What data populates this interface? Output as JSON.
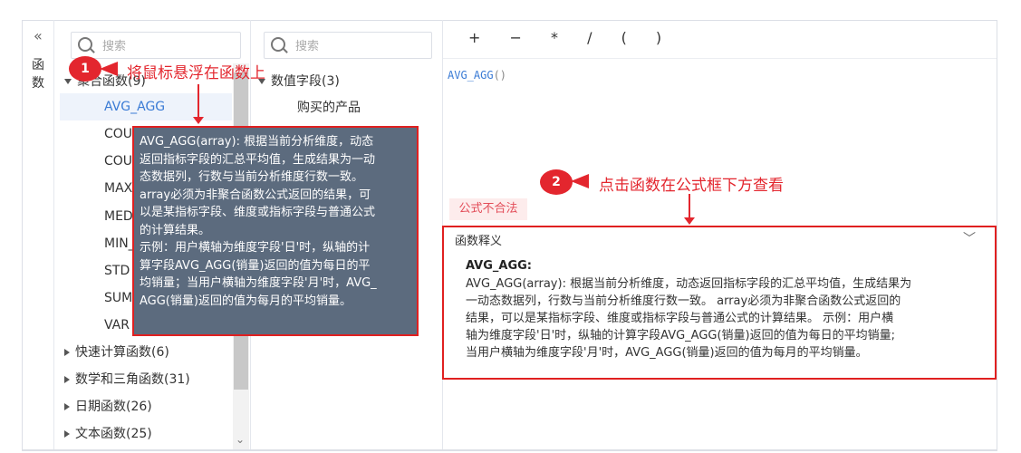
{
  "sidebar": {
    "label_chars": [
      "函",
      "数"
    ],
    "collapse_icon": "double-chevron-left-icon"
  },
  "function_panel": {
    "search_placeholder": "搜索",
    "groups": [
      {
        "label": "聚合函数(9)",
        "expanded": true
      },
      {
        "label": "快速计算函数(6)",
        "expanded": false
      },
      {
        "label": "数学和三角函数(31)",
        "expanded": false
      },
      {
        "label": "日期函数(26)",
        "expanded": false
      },
      {
        "label": "文本函数(25)",
        "expanded": false
      }
    ],
    "items": [
      "AVG_AGG",
      "COU",
      "COU",
      "MAX",
      "MED",
      "MIN_",
      "STD",
      "SUM",
      "VAR"
    ]
  },
  "field_panel": {
    "search_placeholder": "搜索",
    "group": "数值字段(3)",
    "items": [
      "购买的产品"
    ]
  },
  "editor": {
    "operators": [
      "+",
      "−",
      "*",
      "/",
      "(",
      ")"
    ],
    "formula_name": "AVG_AGG",
    "formula_parens": "()",
    "invalid_label": "公式不合法"
  },
  "explanation": {
    "title": "函数释义",
    "name": "AVG_AGG:",
    "lines": [
      "AVG_AGG(array): 根据当前分析维度，动态返回指标字段的汇总平均值，生成结果为",
      "一动态数据列，行数与当前分析维度行数一致。  array必须为非聚合函数公式返回的",
      "结果，可以是某指标字段、维度或指标字段与普通公式的计算结果。  示例：用户横",
      "轴为维度字段'日'时，纵轴的计算字段AVG_AGG(销量)返回的值为每日的平均销量;",
      "当用户横轴为维度字段'月'时，AVG_AGG(销量)返回的值为每月的平均销量。"
    ]
  },
  "tooltip": {
    "lines": [
      "AVG_AGG(array): 根据当前分析维度，动态",
      "返回指标字段的汇总平均值，生成结果为一动",
      "态数据列，行数与当前分析维度行数一致。",
      " array必须为非聚合函数公式返回的结果，可",
      "以是某指标字段、维度或指标字段与普通公式",
      "的计算结果。",
      " 示例：用户横轴为维度字段'日'时，纵轴的计",
      "算字段AVG_AGG(销量)返回的值为每日的平",
      "均销量；当用户横轴为维度字段'月'时，AVG_",
      "AGG(销量)返回的值为每月的平均销量。"
    ]
  },
  "annotations": {
    "step1_number": "1",
    "step1_text": "将鼠标悬浮在函数上",
    "step2_number": "2",
    "step2_text": "点击函数在公式框下方查看",
    "accent_color": "#e3262e"
  }
}
